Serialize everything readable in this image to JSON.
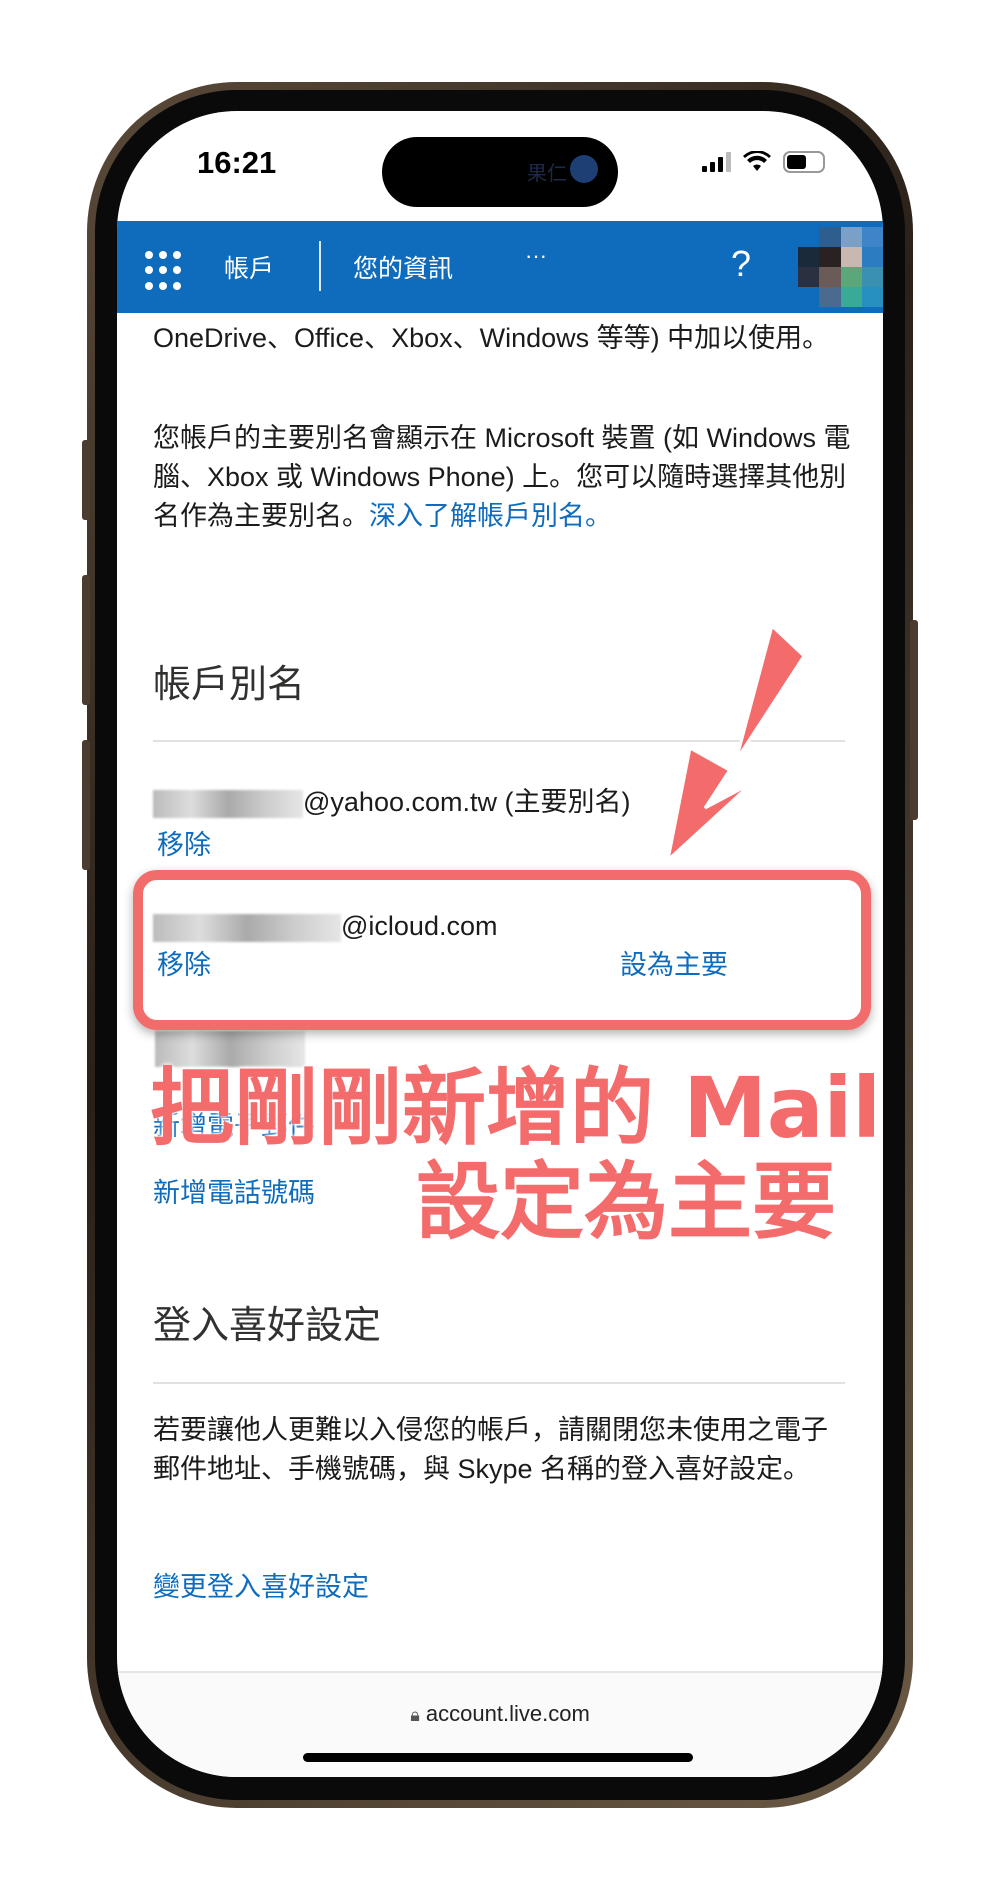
{
  "status_bar": {
    "time": "16:21",
    "island_label": "果仁"
  },
  "header": {
    "nav_account": "帳戶",
    "nav_info": "您的資訊",
    "more": "···",
    "help": "?"
  },
  "content": {
    "intro_tail": "OneDrive、Office、Xbox、Windows 等等) 中加以使用。",
    "primary_alias_desc": "您帳戶的主要別名會顯示在 Microsoft 裝置 (如 Windows 電腦、Xbox 或 Windows Phone) 上。您可以隨時選擇其他別名作為主要別名。",
    "learn_more_link": "深入了解帳戶別名。",
    "aliases_heading": "帳戶別名",
    "aliases": [
      {
        "email_suffix": "@yahoo.com.tw (主要別名)",
        "remove": "移除"
      },
      {
        "email_suffix": "@icloud.com",
        "remove": "移除",
        "make_primary": "設為主要"
      }
    ],
    "add_email": "新增電子郵件",
    "add_phone": "新增電話號碼",
    "signin_heading": "登入喜好設定",
    "signin_desc": "若要讓他人更難以入侵您的帳戶，請關閉您未使用之電子郵件地址、手機號碼，與 Skype 名稱的登入喜好設定。",
    "change_signin": "變更登入喜好設定"
  },
  "browser": {
    "url": "account.live.com"
  },
  "annotation": {
    "line1": "把剛剛新增的 Mail",
    "line2": "設定為主要",
    "color": "#f46b6b"
  },
  "colors": {
    "header": "#0f6cbd",
    "link": "#0f6cbd"
  }
}
